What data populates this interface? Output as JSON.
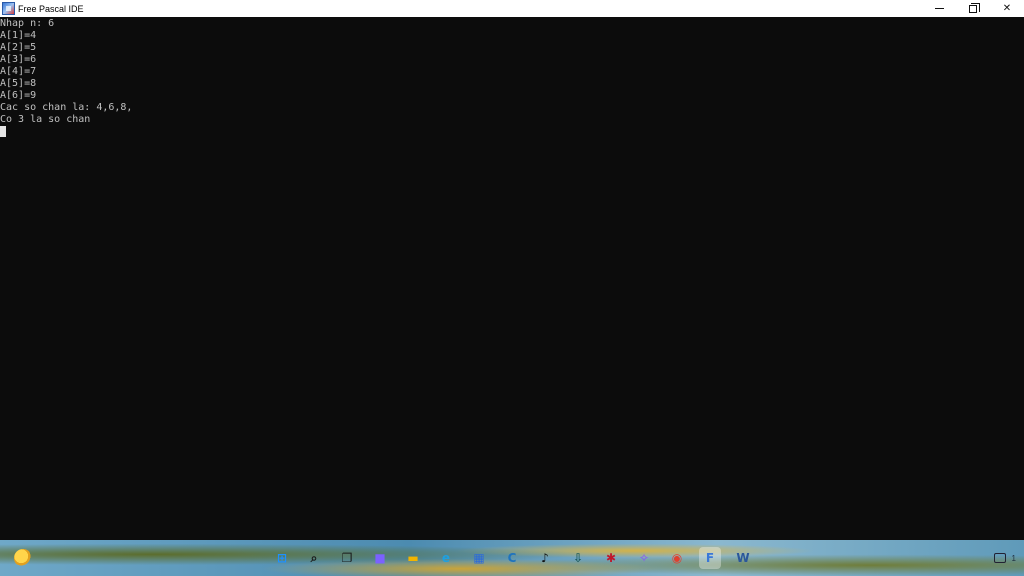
{
  "window": {
    "title": "Free Pascal IDE",
    "icon": "free-pascal-ide-icon",
    "minimize_glyph": "minimize-icon",
    "maximize_glyph": "restore-icon",
    "close_glyph": "✕"
  },
  "console": {
    "background": "#0c0c0c",
    "text_color": "#c0c0c0",
    "lines": [
      "Nhap n: 6",
      "A[1]=4",
      "A[2]=5",
      "A[3]=6",
      "A[4]=7",
      "A[5]=8",
      "A[6]=9",
      "Cac so chan la: 4,6,8,",
      "Co 3 la so chan"
    ]
  },
  "taskbar": {
    "widgets_icon": "weather-icon",
    "items": [
      {
        "name": "start-icon",
        "glyph": "⊞",
        "color": "#1e90ff"
      },
      {
        "name": "search-icon",
        "glyph": "⌕",
        "color": "#1a1a1a"
      },
      {
        "name": "task-view-icon",
        "glyph": "❐",
        "color": "#1a1a1a"
      },
      {
        "name": "meet-icon",
        "glyph": "■",
        "color": "#7b61ff"
      },
      {
        "name": "file-explorer-icon",
        "glyph": "▬",
        "color": "#f2b400"
      },
      {
        "name": "edge-icon",
        "glyph": "e",
        "color": "#1fa0e0"
      },
      {
        "name": "store-icon",
        "glyph": "▦",
        "color": "#2d6ad8"
      },
      {
        "name": "app-c-icon",
        "glyph": "C",
        "color": "#1e73be"
      },
      {
        "name": "tiktok-icon",
        "glyph": "♪",
        "color": "#111111"
      },
      {
        "name": "app-download-icon",
        "glyph": "⇩",
        "color": "#1f5c5c"
      },
      {
        "name": "app-red-icon",
        "glyph": "✱",
        "color": "#c0182c"
      },
      {
        "name": "messenger-icon",
        "glyph": "✧",
        "color": "#8a4dff"
      },
      {
        "name": "chrome-icon",
        "glyph": "◉",
        "color": "#e04030"
      },
      {
        "name": "free-pascal-taskbar-icon",
        "glyph": "F",
        "color": "#3a78d8",
        "active": true
      },
      {
        "name": "word-icon",
        "glyph": "W",
        "color": "#2b579a"
      }
    ],
    "tray_badge": "1"
  }
}
